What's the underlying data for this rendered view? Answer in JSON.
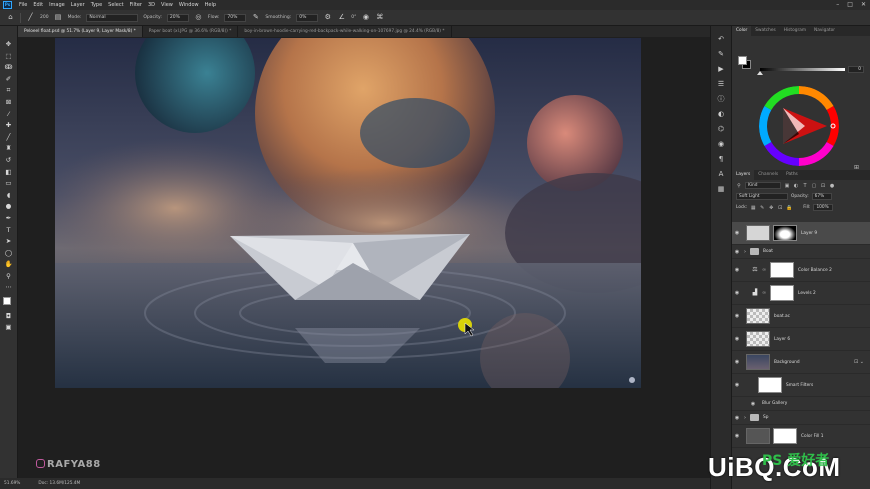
{
  "app": {
    "logo": "Ps",
    "menu": [
      "File",
      "Edit",
      "Image",
      "Layer",
      "Type",
      "Select",
      "Filter",
      "3D",
      "View",
      "Window",
      "Help"
    ]
  },
  "options": {
    "mode_label": "Mode:",
    "mode_value": "Normal",
    "opacity_label": "Opacity:",
    "opacity_value": "20%",
    "flow_label": "Flow:",
    "flow_value": "70%",
    "smoothing_label": "Smoothing:",
    "smoothing_value": "0%",
    "angle_value": "0°",
    "brush_size": "200"
  },
  "tabs": [
    {
      "label": "Peloeel float.psd @ 51.7% (Layer 9, Layer Mask/8) *",
      "active": true
    },
    {
      "label": "Paper boat (xl.JPG @ 36.6% (RGB/8)) *",
      "active": false
    },
    {
      "label": "boy-in-brown-hoodie-carrying-red-backpack-while-walking-on-107697.jpg @ 24.4% (RGB/8) *",
      "active": false
    }
  ],
  "status": {
    "zoom": "51.69%",
    "doc": "Doc: 13.6M/125.4M"
  },
  "watermark": {
    "handle": "RAFYA88",
    "site_main": "UiBQ.CoM",
    "site_sub": "PS 爱好者"
  },
  "color_panel": {
    "tabs": [
      "Color",
      "Swatches",
      "Histogram",
      "Navigator"
    ],
    "slider_value": "0",
    "slider_fraction": 0.0
  },
  "layers_panel": {
    "tabs": [
      "Layers",
      "Channels",
      "Paths"
    ],
    "filter_kind": "Kind",
    "blend_mode": "Soft Light",
    "opacity_label": "Opacity:",
    "opacity_value": "67%",
    "lock_label": "Lock:",
    "fill_label": "Fill:",
    "fill_value": "100%",
    "layers": [
      {
        "name": "Layer 9",
        "type": "mask",
        "selected": true
      },
      {
        "name": "Boat",
        "type": "group"
      },
      {
        "name": "Color Balance 2",
        "type": "adjustment"
      },
      {
        "name": "Levels 2",
        "type": "adjustment"
      },
      {
        "name": "boat.ac",
        "type": "pixel"
      },
      {
        "name": "Layer 6",
        "type": "pixel"
      },
      {
        "name": "Background",
        "type": "smart"
      },
      {
        "name": "Smart Filters",
        "type": "smartfilter"
      },
      {
        "name": "Blur Gallery",
        "type": "filter"
      },
      {
        "name": "Sp",
        "type": "group"
      },
      {
        "name": "Color Fill 1",
        "type": "fill"
      }
    ]
  },
  "colors": {
    "accent": "#31a8ff",
    "panel": "#323232",
    "selected_layer": "#4a4a4a"
  }
}
